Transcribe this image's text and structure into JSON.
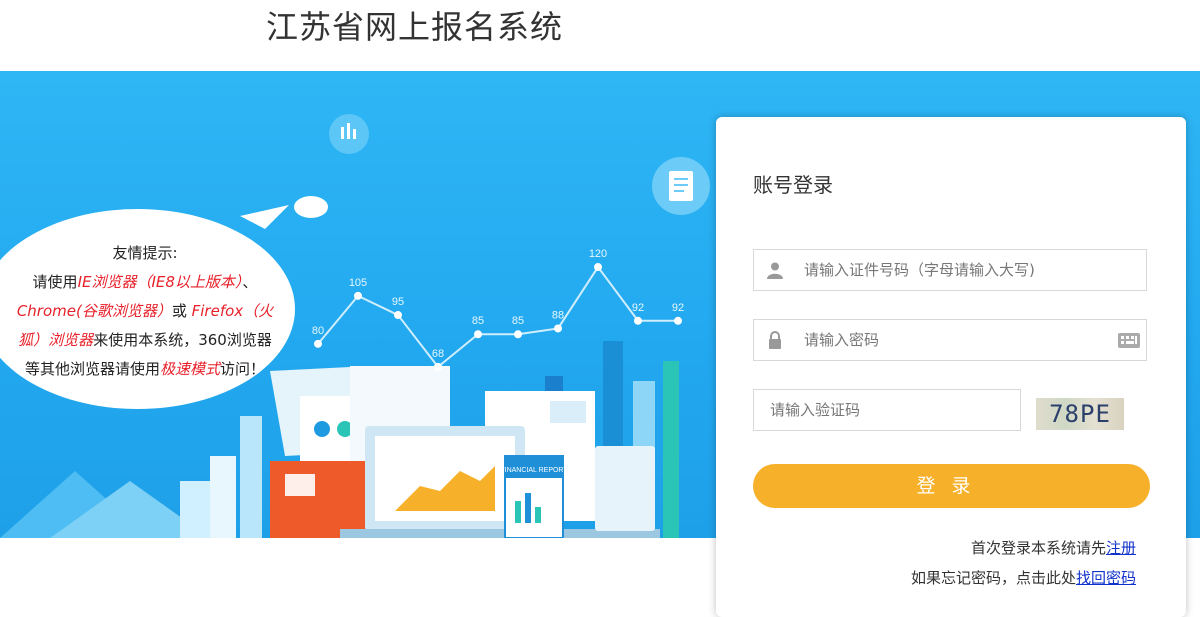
{
  "header": {
    "title": "江苏省网上报名系统"
  },
  "tip": {
    "line1": "友情提示:",
    "line2_pre": "请使用",
    "line2_red": "IE浏览器（IE8以上版本）",
    "line2_post": "、",
    "line3_red": "Chrome(谷歌浏览器）",
    "line3_mid": "或 ",
    "line3_red2": "Firefox（火",
    "line4_red": "狐）浏览器",
    "line4_post": "来使用本系统，360浏览器",
    "line5_pre": "等其他浏览器请使用",
    "line5_red": "极速模式",
    "line5_post": "访问！"
  },
  "chart_data": {
    "type": "line",
    "values": [
      80,
      105,
      95,
      68,
      85,
      85,
      88,
      120,
      92,
      92
    ]
  },
  "illustration": {
    "report_label": "FINANCIAL REPORT"
  },
  "login": {
    "title": "账号登录",
    "id_placeholder": "请输入证件号码（字母请输入大写)",
    "password_placeholder": "请输入密码",
    "captcha_placeholder": "请输入验证码",
    "captcha_text": "78PE",
    "submit_label": "登录",
    "register_text": "首次登录本系统请先",
    "register_link": "注册",
    "forgot_text": "如果忘记密码，点击此处",
    "forgot_link": "找回密码"
  },
  "colors": {
    "banner": "#22a8ef",
    "button": "#f7b02a",
    "tip_red": "#e8202a",
    "link": "#1133cc"
  }
}
